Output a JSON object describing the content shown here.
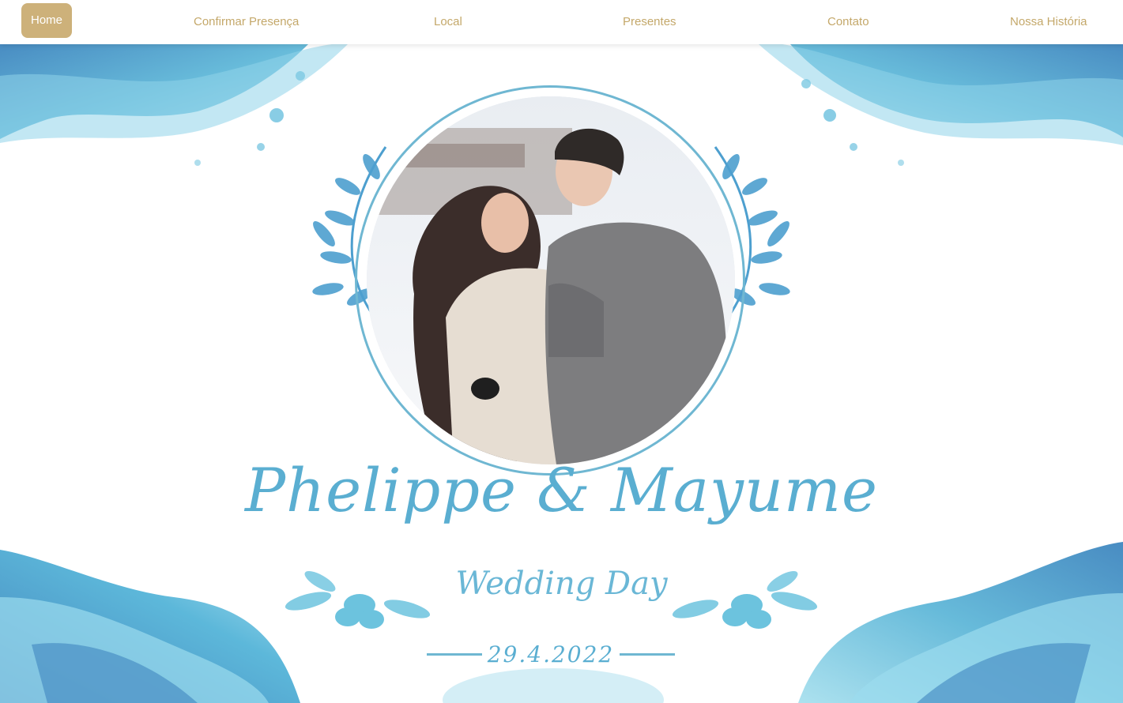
{
  "nav": {
    "items": [
      {
        "label": "Home",
        "active": true
      },
      {
        "label": "Confirmar Presença",
        "active": false
      },
      {
        "label": "Local",
        "active": false
      },
      {
        "label": "Presentes",
        "active": false
      },
      {
        "label": "Contato",
        "active": false
      },
      {
        "label": "Nossa História",
        "active": false
      }
    ]
  },
  "hero": {
    "names": "Phelippe & Mayume",
    "subtitle": "Wedding Day",
    "date": "29.4.2022"
  },
  "colors": {
    "accent": "#cdb17a",
    "nav_text": "#c4a86a",
    "watercolor": "#5aaed1"
  }
}
